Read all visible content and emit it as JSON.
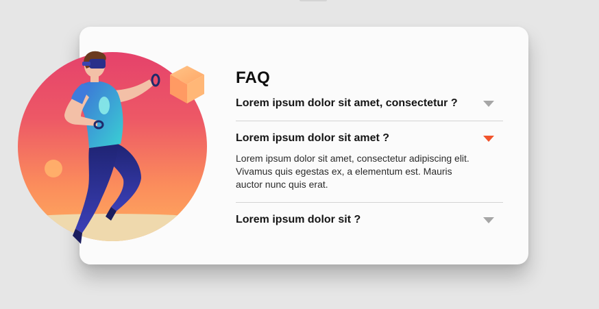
{
  "faq": {
    "title": "FAQ",
    "items": [
      {
        "question": "Lorem ipsum dolor sit amet, consectetur ?",
        "expanded": false,
        "chevron_icon": "chevron-down-icon"
      },
      {
        "question": "Lorem ipsum dolor sit amet ?",
        "expanded": true,
        "chevron_icon": "chevron-down-icon",
        "answer": "Lorem ipsum dolor sit amet, consectetur adipiscing elit. Vivamus quis egestas ex, a elementum est. Mauris auctor nunc quis erat."
      },
      {
        "question": "Lorem ipsum dolor sit ?",
        "expanded": false,
        "chevron_icon": "chevron-down-icon"
      }
    ]
  },
  "illustration": {
    "name": "vr-person-illustration",
    "icons": [
      "vr-headset-icon",
      "cube-icon"
    ]
  },
  "colors": {
    "background": "#e6e6e6",
    "card": "#fbfbfb",
    "accent": "#f1542c",
    "chevron_inactive": "#a6a6a6",
    "circle_top": "#e6456a",
    "circle_bottom": "#ffa65b"
  }
}
